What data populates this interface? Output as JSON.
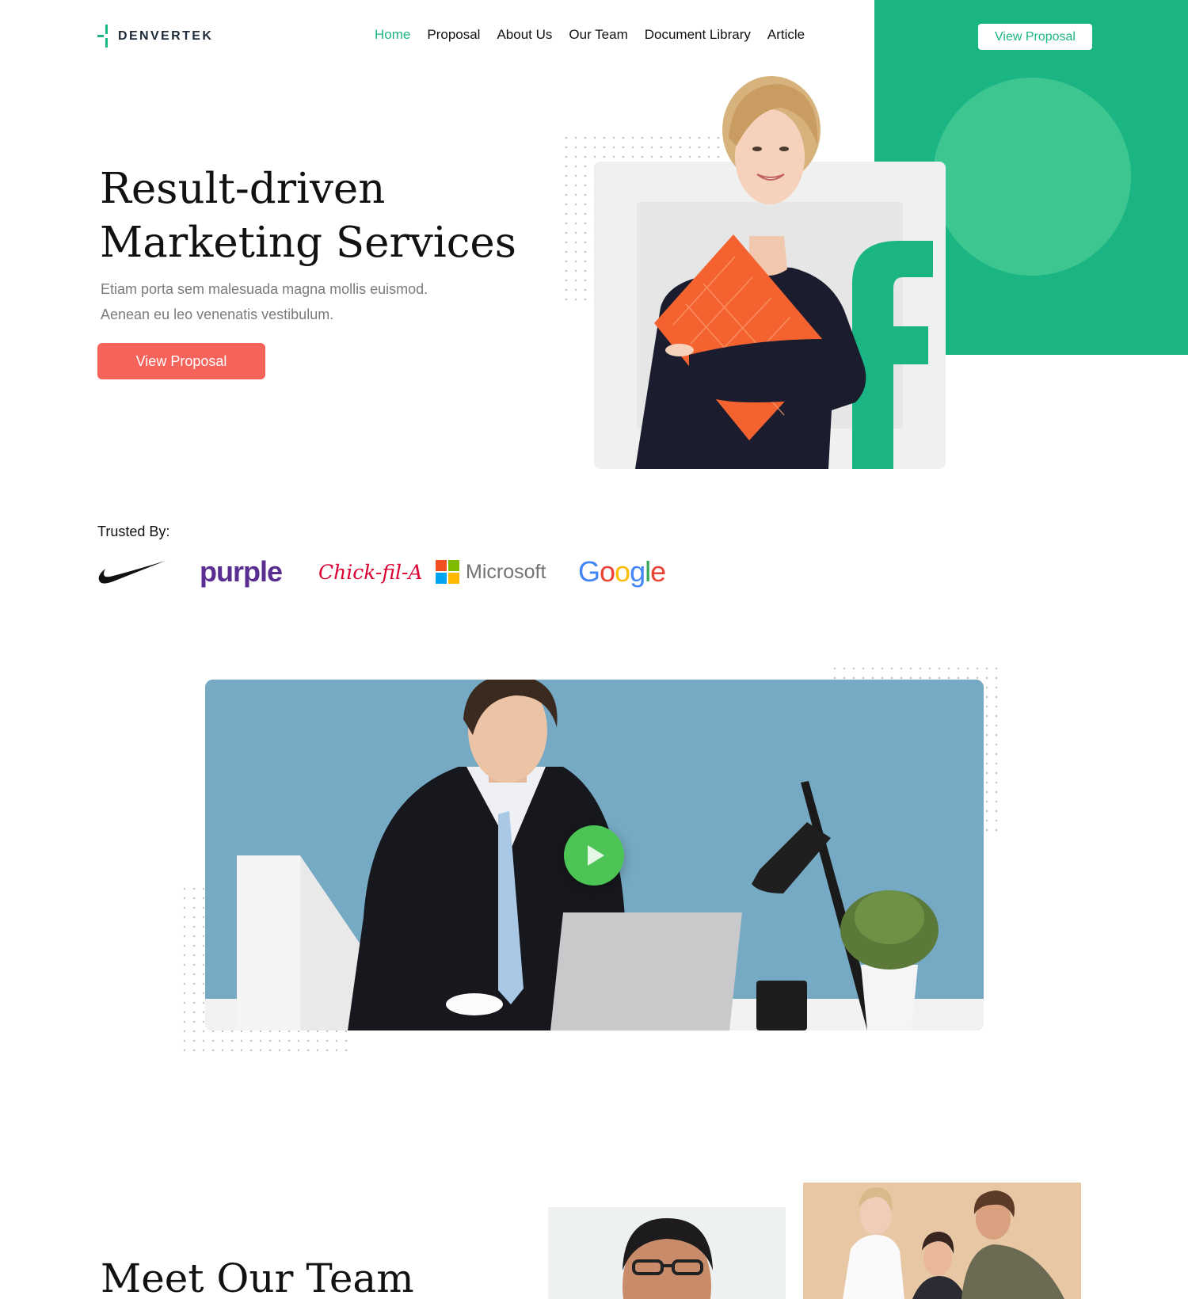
{
  "header": {
    "logo_text": "DENVERTEK",
    "nav": [
      "Home",
      "Proposal",
      "About Us",
      "Our Team",
      "Document Library",
      "Article"
    ],
    "active_nav": "Home",
    "cta_label": "View Proposal"
  },
  "hero": {
    "title_line1": "Result-driven",
    "title_line2": "Marketing Services",
    "subtitle_line1": "Etiam porta sem malesuada magna mollis euismod.",
    "subtitle_line2": "Aenean eu leo venenatis vestibulum.",
    "cta_label": "View Proposal"
  },
  "trusted": {
    "label": "Trusted By:",
    "brands": [
      "Nike",
      "purple",
      "Chick-fil-A",
      "Microsoft",
      "Google"
    ]
  },
  "video": {
    "play_icon": "play-icon"
  },
  "team": {
    "title": "Meet Our Team"
  },
  "colors": {
    "accent": "#1bb584",
    "cta": "#f5635a",
    "circle": "#3ec690",
    "play": "#4cc555"
  }
}
